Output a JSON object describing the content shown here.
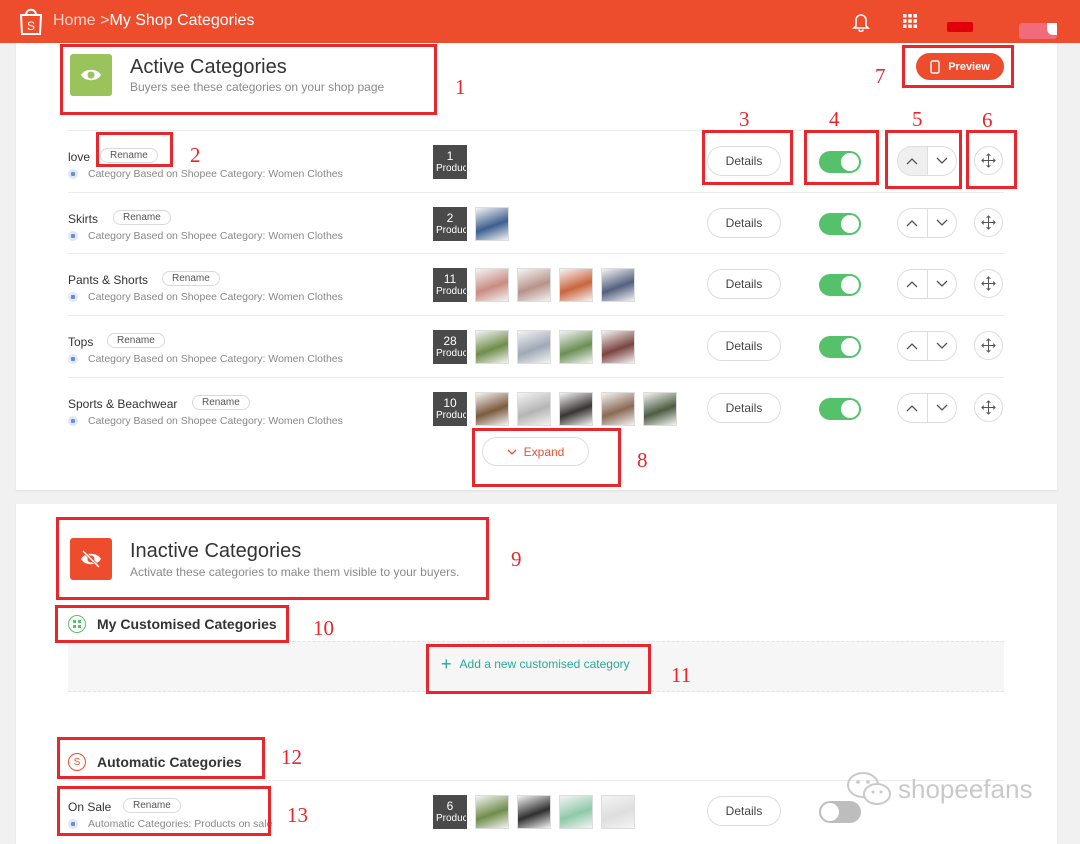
{
  "topbar": {
    "logo_letter": "S",
    "home": "Home",
    "separator": ">",
    "current": "My Shop Categories"
  },
  "active_section": {
    "title": "Active Categories",
    "subtitle": "Buyers see these categories on your shop page",
    "preview_label": "Preview",
    "expand_label": "Expand"
  },
  "rename_label": "Rename",
  "details_label": "Details",
  "products_label": "Produc",
  "active_rows": [
    {
      "name": "love",
      "sub": "Category Based on Shopee Category: Women Clothes",
      "count": "1",
      "enabled": true,
      "thumbs": []
    },
    {
      "name": "Skirts",
      "sub": "Category Based on Shopee Category: Women Clothes",
      "count": "2",
      "enabled": true,
      "thumbs": [
        "#3d5f8f"
      ]
    },
    {
      "name": "Pants & Shorts",
      "sub": "Category Based on Shopee Category: Women Clothes",
      "count": "11",
      "enabled": true,
      "thumbs": [
        "#c98b82",
        "#b7938a",
        "#c9653f",
        "#53607f"
      ]
    },
    {
      "name": "Tops",
      "sub": "Category Based on Shopee Category: Women Clothes",
      "count": "28",
      "enabled": true,
      "thumbs": [
        "#6f8d4a",
        "#9fa8b5",
        "#6b8f55",
        "#7a4440"
      ]
    },
    {
      "name": "Sports & Beachwear",
      "sub": "Category Based on Shopee Category: Women Clothes",
      "count": "10",
      "enabled": true,
      "thumbs": [
        "#7c5a3f",
        "#b5b5b5",
        "#3a3535",
        "#8a6a55",
        "#4c5d42"
      ]
    }
  ],
  "inactive_section": {
    "title": "Inactive Categories",
    "subtitle": "Activate these categories to make them visible to your buyers.",
    "customised_title": "My Customised Categories",
    "add_label": "Add a new customised category",
    "automatic_title": "Automatic Categories",
    "automatic_icon_letter": "S"
  },
  "automatic_rows": [
    {
      "name": "On Sale",
      "sub": "Automatic Categories: Products on sale",
      "count": "6",
      "enabled": false,
      "thumbs": [
        "#6f8d4a",
        "#2f2f2f",
        "#8ec9a8",
        "#dedede"
      ]
    }
  ],
  "annotations": [
    "1",
    "2",
    "3",
    "4",
    "5",
    "6",
    "7",
    "8",
    "9",
    "10",
    "11",
    "12",
    "13"
  ],
  "watermark": "shopeefans",
  "colors": {
    "brand": "#ee4d2d",
    "toggle_on": "#55c26b",
    "annotation": "#e8262c",
    "add_link": "#26aa99",
    "eye_icon_bg": "#9ac35c"
  }
}
